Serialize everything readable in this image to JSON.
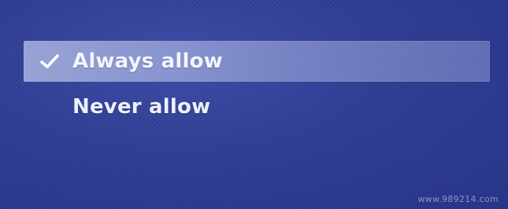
{
  "menu": {
    "items": [
      {
        "label": "Always allow",
        "selected": true
      },
      {
        "label": "Never allow",
        "selected": false
      }
    ]
  },
  "watermark": "www.989214.com",
  "colors": {
    "background": "#2c3a8f",
    "highlight": "#c8d1f2",
    "text": "#f2f4ff"
  },
  "icons": {
    "selected_marker": "checkmark-icon"
  }
}
